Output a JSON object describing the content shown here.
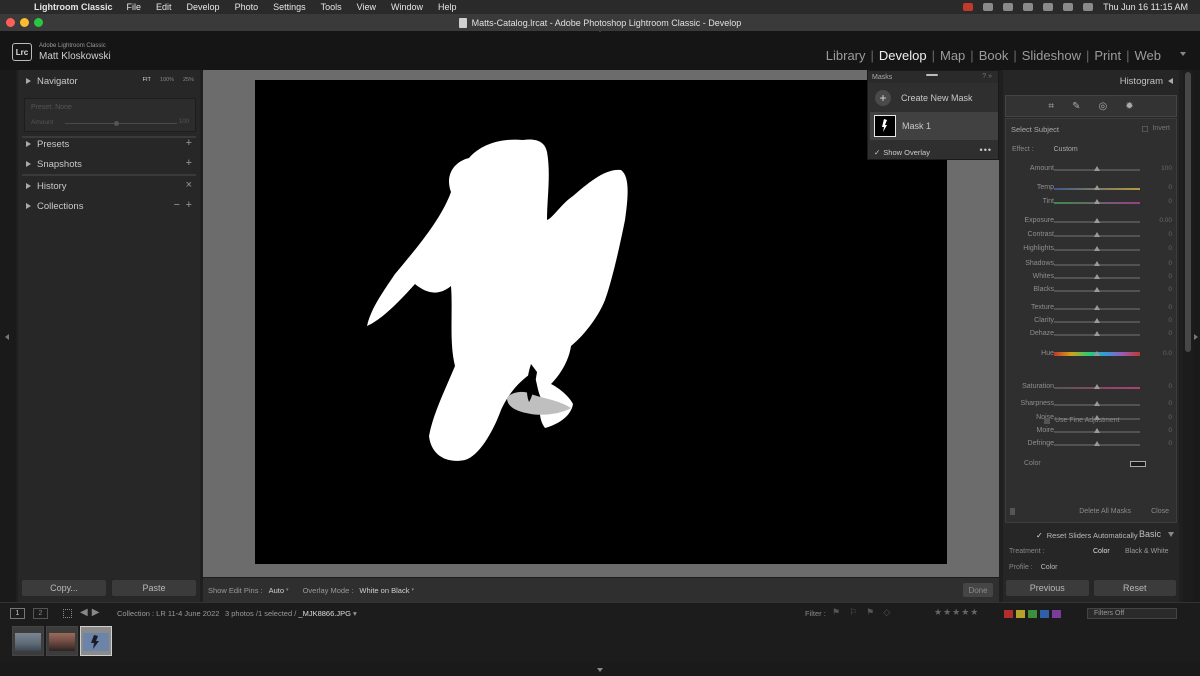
{
  "menubar": {
    "app_name": "Lightroom Classic",
    "items": [
      "File",
      "Edit",
      "Develop",
      "Photo",
      "Settings",
      "Tools",
      "View",
      "Window",
      "Help"
    ],
    "clock": "Thu Jun 16  11:15 AM"
  },
  "window": {
    "title": "Matts-Catalog.lrcat - Adobe Photoshop Lightroom Classic - Develop",
    "traffic_colors": [
      "#ff5f57",
      "#febc2e",
      "#28c840"
    ]
  },
  "identity": {
    "logo": "Lrc",
    "subtitle": "Adobe Lightroom Classic",
    "name": "Matt Kloskowski"
  },
  "modules": [
    {
      "label": "Library",
      "active": false
    },
    {
      "label": "Develop",
      "active": true
    },
    {
      "label": "Map",
      "active": false
    },
    {
      "label": "Book",
      "active": false
    },
    {
      "label": "Slideshow",
      "active": false
    },
    {
      "label": "Print",
      "active": false
    },
    {
      "label": "Web",
      "active": false
    }
  ],
  "left_panel": {
    "navigator": {
      "label": "Navigator",
      "zoom": [
        "FIT",
        "100%",
        "25%"
      ]
    },
    "navigator_preview": {
      "preset_label": "Preset: None",
      "amount_label": "Amount",
      "amount_value": "100"
    },
    "presets": "Presets",
    "snapshots": "Snapshots",
    "history": "History",
    "collections": "Collections",
    "copy_button": "Copy...",
    "paste_button": "Paste"
  },
  "masks_panel": {
    "title": "Masks",
    "create_label": "Create New Mask",
    "mask_name": "Mask 1",
    "show_overlay": "Show Overlay"
  },
  "toolbar": {
    "show_edit_pins_label": "Show Edit Pins :",
    "show_edit_pins_value": "Auto",
    "overlay_mode_label": "Overlay Mode :",
    "overlay_mode_value": "White on Black",
    "done_button": "Done"
  },
  "right_panel": {
    "histogram_label": "Histogram",
    "tool_icons": [
      "mask-icon",
      "brush-icon",
      "radial-icon",
      "gear-icon"
    ],
    "select_subject": "Select Subject",
    "invert": "Invert",
    "effect_label": "Effect :",
    "effect_value": "Custom",
    "sliders": [
      {
        "label": "Amount",
        "value": "100",
        "fraction": 0.5
      },
      {
        "label": "Temp",
        "value": "0",
        "fraction": 0.5
      },
      {
        "label": "Tint",
        "value": "0",
        "fraction": 0.5
      },
      {
        "label": "Exposure",
        "value": "0.00",
        "fraction": 0.5
      },
      {
        "label": "Contrast",
        "value": "0",
        "fraction": 0.5
      },
      {
        "label": "Highlights",
        "value": "0",
        "fraction": 0.5
      },
      {
        "label": "Shadows",
        "value": "0",
        "fraction": 0.5
      },
      {
        "label": "Whites",
        "value": "0",
        "fraction": 0.5
      },
      {
        "label": "Blacks",
        "value": "0",
        "fraction": 0.5
      },
      {
        "label": "Texture",
        "value": "0",
        "fraction": 0.5
      },
      {
        "label": "Clarity",
        "value": "0",
        "fraction": 0.5
      },
      {
        "label": "Dehaze",
        "value": "0",
        "fraction": 0.5
      },
      {
        "label": "Hue",
        "value": "0.0",
        "fraction": 0.5
      },
      {
        "label": "Saturation",
        "value": "0",
        "fraction": 0.5
      },
      {
        "label": "Sharpness",
        "value": "0",
        "fraction": 0.5
      },
      {
        "label": "Noise",
        "value": "0",
        "fraction": 0.5
      },
      {
        "label": "Moire",
        "value": "0",
        "fraction": 0.5
      },
      {
        "label": "Defringe",
        "value": "0",
        "fraction": 0.5
      }
    ],
    "fine_adjustment": "Use Fine Adjustment",
    "color_label": "Color",
    "reset_label": "Reset Sliders Automatically",
    "delete_all": "Delete All Masks",
    "close": "Close",
    "basic_label": "Basic",
    "treatment_label": "Treatment :",
    "treatment_color": "Color",
    "treatment_bw": "Black & White",
    "profile_label": "Profile :",
    "profile_value": "Color",
    "previous_button": "Previous",
    "reset_button": "Reset"
  },
  "filmstrip_bar": {
    "view_1": "1",
    "view_2": "2",
    "source": "Collection : LR 11-4 June 2022",
    "count": "3 photos /1 selected /",
    "filename": "_MJK8866.JPG",
    "filter_label": "Filter :",
    "stars": "★★★★★",
    "label_colors": [
      "#b02e2e",
      "#b8a12a",
      "#3d8f3d",
      "#2e5fa8",
      "#7a3d9a"
    ],
    "filters_off": "Filters Off"
  },
  "filmstrip": {
    "count": 3
  }
}
